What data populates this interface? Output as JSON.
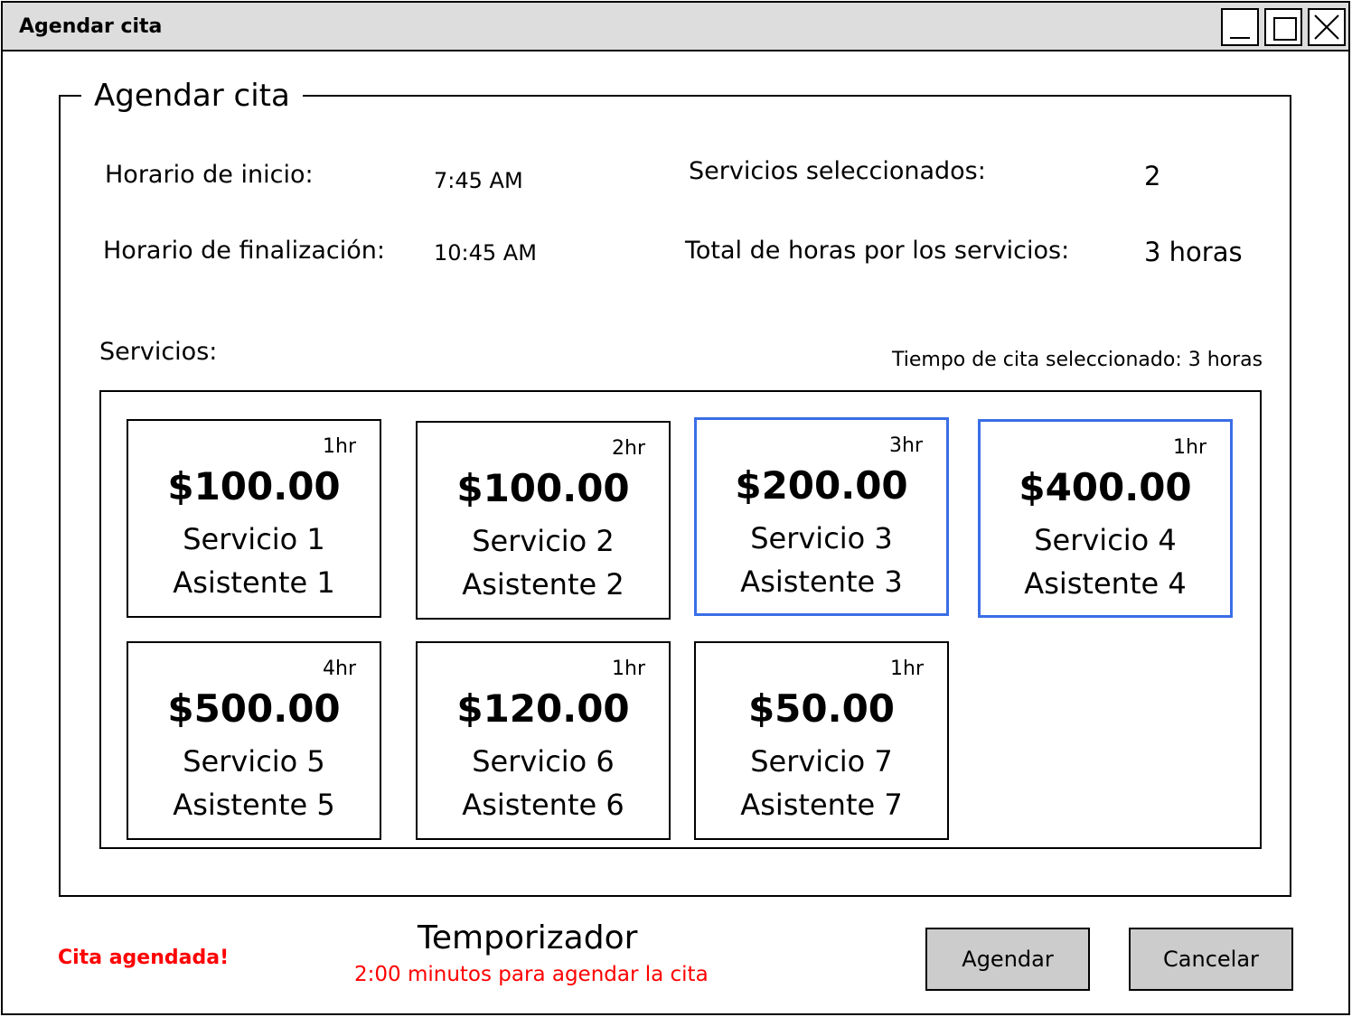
{
  "window": {
    "title": "Agendar cita"
  },
  "form": {
    "legend": "Agendar cita",
    "start_label": "Horario de inicio:",
    "start_value": "7:45 AM",
    "end_label": "Horario de finalización:",
    "end_value": "10:45 AM",
    "selected_label": "Servicios seleccionados:",
    "selected_value": "2",
    "total_label": "Total de horas por los servicios:",
    "total_value": "3 horas",
    "services_label": "Servicios:",
    "selected_time": "Tiempo de cita seleccionado: 3 horas"
  },
  "services": [
    {
      "hours": "1hr",
      "price": "$100.00",
      "name": "Servicio 1",
      "assistant": "Asistente 1",
      "selected": false
    },
    {
      "hours": "2hr",
      "price": "$100.00",
      "name": "Servicio 2",
      "assistant": "Asistente 2",
      "selected": false
    },
    {
      "hours": "3hr",
      "price": "$200.00",
      "name": "Servicio 3",
      "assistant": "Asistente 3",
      "selected": true
    },
    {
      "hours": "1hr",
      "price": "$400.00",
      "name": "Servicio 4",
      "assistant": "Asistente 4",
      "selected": true
    },
    {
      "hours": "4hr",
      "price": "$500.00",
      "name": "Servicio 5",
      "assistant": "Asistente 5",
      "selected": false
    },
    {
      "hours": "1hr",
      "price": "$120.00",
      "name": "Servicio 6",
      "assistant": "Asistente 6",
      "selected": false
    },
    {
      "hours": "1hr",
      "price": "$50.00",
      "name": "Servicio 7",
      "assistant": "Asistente 7",
      "selected": false
    }
  ],
  "footer": {
    "status": "Cita agendada!",
    "timer_title": "Temporizador",
    "timer_message": "2:00 minutos para agendar la cita",
    "agendar_label": "Agendar",
    "cancelar_label": "Cancelar"
  },
  "colors": {
    "selected_border": "#3a6ee6",
    "status_text": "#ff0000",
    "titlebar": "#dddddd",
    "button": "#cccccc"
  }
}
